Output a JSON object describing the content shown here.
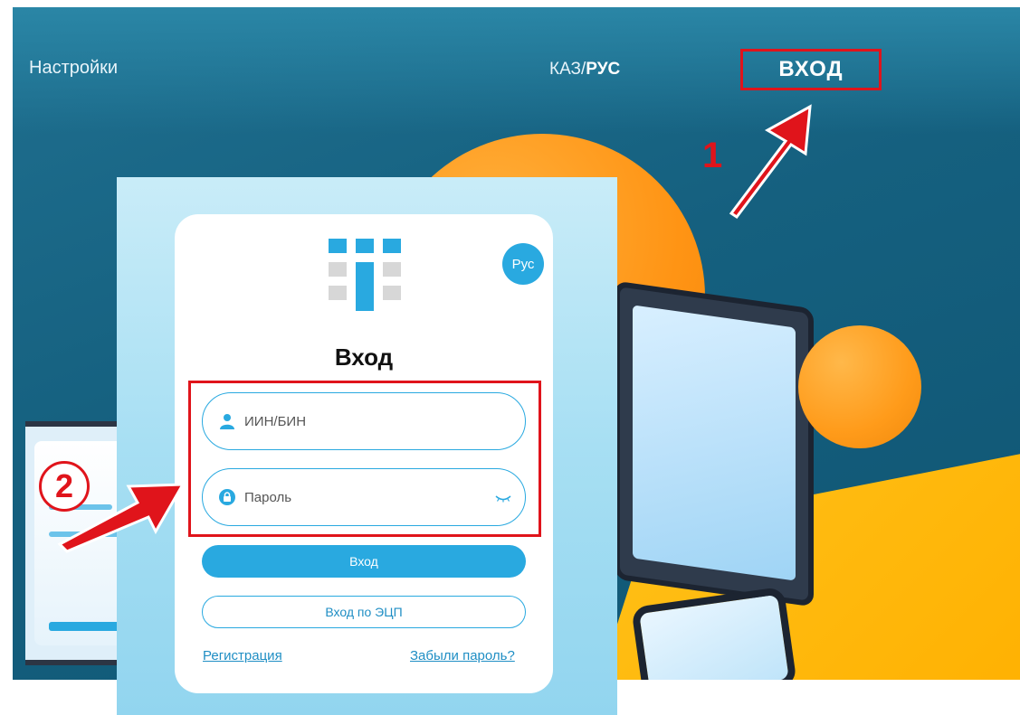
{
  "nav": {
    "settings": "Настройки",
    "lang_kaz": "КАЗ",
    "lang_sep": "/",
    "lang_rus": "РУС",
    "login": "ВХОД"
  },
  "annotations": {
    "step1": "1",
    "step2": "2",
    "highlight_color": "#e0141b"
  },
  "modal": {
    "lang_button": "Рус",
    "title": "Вход",
    "login_placeholder": "ИИН/БИН",
    "password_placeholder": "Пароль",
    "submit": "Вход",
    "ecp_login": "Вход по ЭЦП",
    "register_link": "Регистрация",
    "forgot_link": "Забыли пароль?"
  },
  "colors": {
    "accent": "#29a9e0",
    "background": "#15607f",
    "orange": "#ff9414",
    "yellow": "#ffb000"
  },
  "icons": {
    "login_field": "user-icon",
    "password_field": "lock-icon",
    "password_toggle": "eye-closed-icon"
  }
}
